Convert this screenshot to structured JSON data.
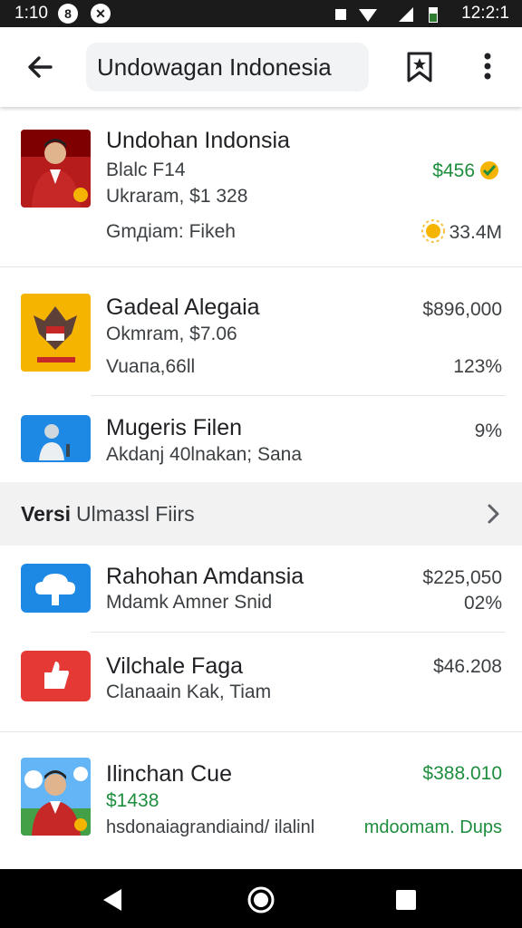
{
  "status_bar": {
    "time": "1:10",
    "clock": "12:2:1"
  },
  "toolbar": {
    "search_value": "Undowagan Indonesia"
  },
  "items_top": [
    {
      "title": "Undohan Indonsia",
      "line1": "Blalc F14",
      "line2": "Ukraram, $1 328",
      "line3": "Gmдiam: Fikeh",
      "value1": "$456",
      "value3": "33.4M"
    },
    {
      "title": "Gadeal Alegaia",
      "line1": "Okmram, $7.06",
      "line2": "Vuaпa,66ll",
      "value1": "$896,000",
      "value2": "123%"
    },
    {
      "title": "Mugeris Filen",
      "line1": "Akdanj 40lnakan; Sana",
      "value1": "9%"
    }
  ],
  "section": {
    "bold": "Versi",
    "text": "Ulmaзsl Fiirs"
  },
  "items_bottom": [
    {
      "title": "Rahohan Amdansia",
      "line1": "Mdamk Amner Snid",
      "value1": "$225,050",
      "value2": "02%"
    },
    {
      "title": "Vilchale Faga",
      "line1": "Clanaain Kak, Tiam",
      "value1": "$46.208"
    },
    {
      "title": "Ilinchan Cue",
      "line1": "$1438",
      "line2": "hsdonaiagrandiaind/ ilalinl",
      "value1": "$388.010",
      "value2": "mdoomam. Dups"
    }
  ],
  "colors": {
    "accent_green": "#1e8e3e",
    "gold": "#f4b400",
    "red": "#e53935",
    "blue": "#1e88e5"
  },
  "icons": [
    "back-arrow-icon",
    "bookmark-icon",
    "more-vert-icon",
    "chevron-right-icon",
    "coin-icon",
    "sun-icon",
    "cloud-icon",
    "like-icon",
    "nav-back-icon",
    "nav-home-icon",
    "nav-recents-icon"
  ]
}
